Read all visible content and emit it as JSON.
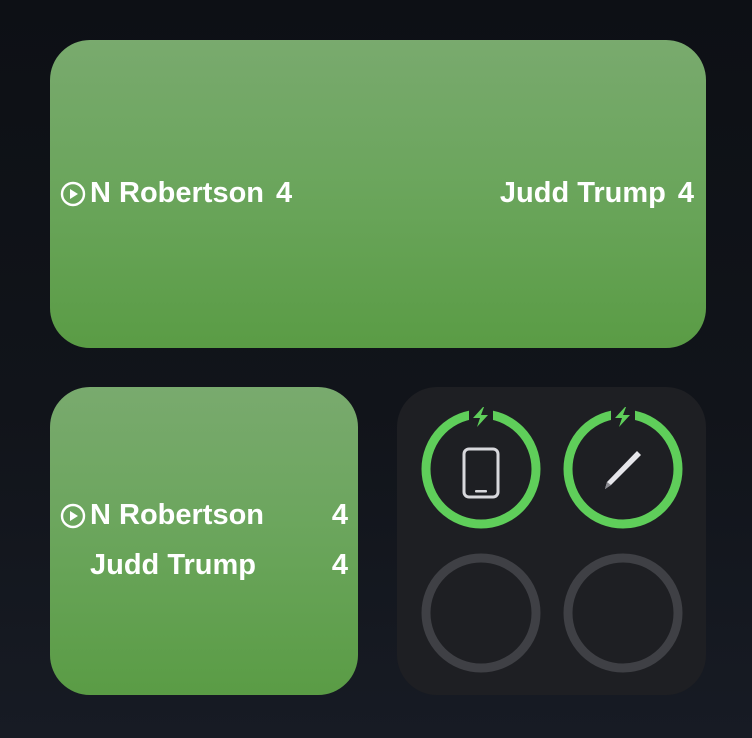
{
  "score_widget_wide": {
    "player1": {
      "name": "N Robertson",
      "score": "4",
      "icon": "play-circle-icon"
    },
    "player2": {
      "name": "Judd Trump",
      "score": "4"
    }
  },
  "score_widget_small": {
    "player1": {
      "name": "N Robertson",
      "score": "4",
      "icon": "play-circle-icon"
    },
    "player2": {
      "name": "Judd Trump",
      "score": "4"
    }
  },
  "battery_widget": {
    "devices": [
      {
        "icon": "ipad-icon",
        "charging": true,
        "level": 1.0
      },
      {
        "icon": "apple-pencil-icon",
        "charging": true,
        "level": 1.0
      },
      {
        "icon": "empty-slot",
        "charging": false,
        "level": 0
      },
      {
        "icon": "empty-slot",
        "charging": false,
        "level": 0
      }
    ]
  },
  "colors": {
    "score_green_top": "#79aa6e",
    "score_green_bottom": "#5a9c45",
    "battery_bg": "#1e1f23",
    "ring_active": "#5fce5a",
    "ring_empty": "#3f4045",
    "text": "#ffffff"
  }
}
